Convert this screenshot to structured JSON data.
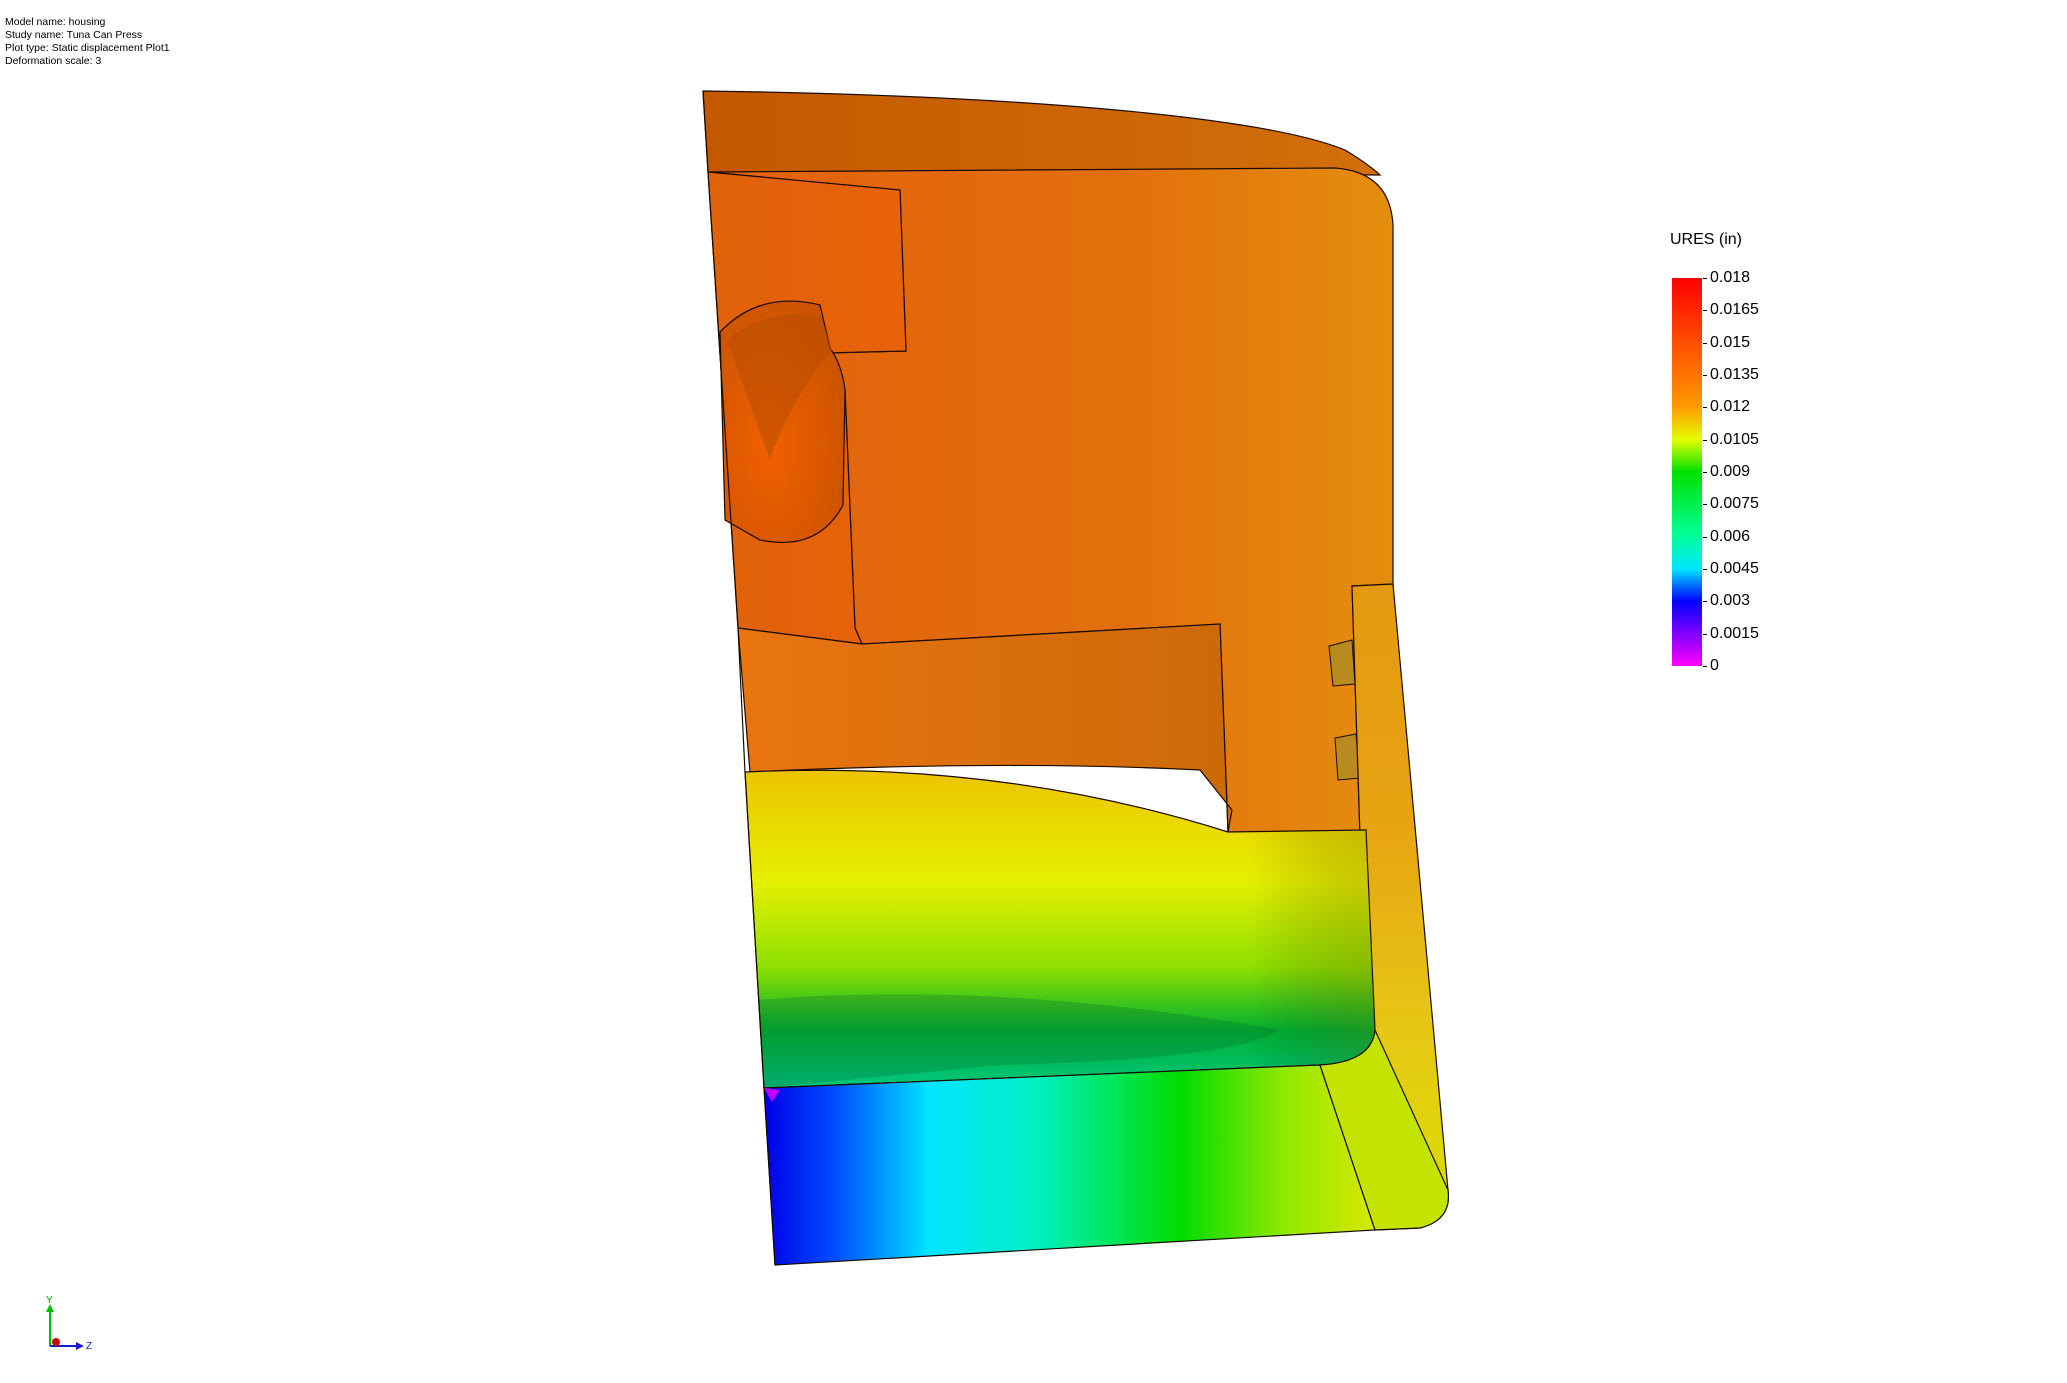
{
  "info": {
    "model_name": "Model name: housing",
    "study_name": "Study name: Tuna Can Press",
    "plot_type": "Plot type: Static displacement Plot1",
    "deformation_scale": "Deformation scale: 3"
  },
  "legend": {
    "title": "URES (in)",
    "ticks": [
      "0.018",
      "0.0165",
      "0.015",
      "0.0135",
      "0.012",
      "0.0105",
      "0.009",
      "0.0075",
      "0.006",
      "0.0045",
      "0.003",
      "0.0015",
      "0"
    ]
  },
  "triad": {
    "y_label": "Y",
    "z_label": "Z"
  },
  "colors": {
    "max": "#ff0000",
    "orange": "#e26a0a",
    "yellow": "#e7e900",
    "green": "#00d000",
    "cyan": "#00e5f0",
    "blue": "#0000ff",
    "min": "#ff00ff"
  }
}
